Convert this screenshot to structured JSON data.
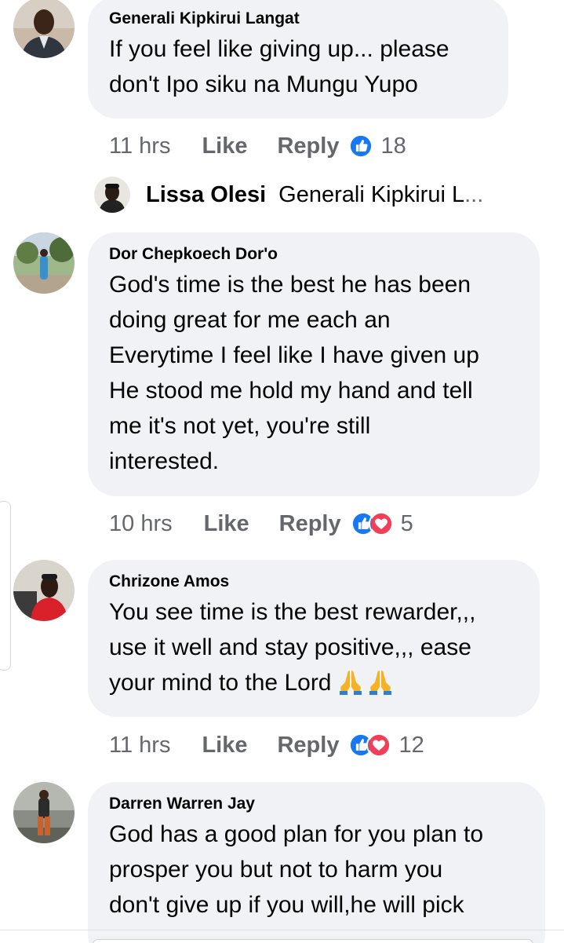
{
  "comments": [
    {
      "author": "Generali Kipkirui Langat",
      "lines": [
        "If you feel like giving up... please",
        "don't Ipo siku na Mungu Yupo"
      ],
      "time": "11 hrs",
      "like_label": "Like",
      "reply_label": "Reply",
      "reactions": [
        "like"
      ],
      "reaction_count": "18"
    },
    {
      "author": "Dor Chepkoech Dor'o",
      "lines": [
        "God's time is the best  he has been",
        "doing great for me each an",
        "Everytime I feel like I have given up",
        "He stood me hold my hand and tell",
        "me it's not yet, you're still",
        "interested."
      ],
      "time": "10 hrs",
      "like_label": "Like",
      "reply_label": "Reply",
      "reactions": [
        "like",
        "love"
      ],
      "reaction_count": "5"
    },
    {
      "author": "Chrizone Amos",
      "lines": [
        "You see time is the best rewarder,,,",
        "use it well and stay positive,,, ease",
        "your mind to the Lord"
      ],
      "emoji": [
        "folded-hands",
        "folded-hands"
      ],
      "time": "11 hrs",
      "like_label": "Like",
      "reply_label": "Reply",
      "reactions": [
        "like",
        "love"
      ],
      "reaction_count": "12"
    },
    {
      "author": "Darren Warren Jay",
      "lines": [
        "God has a good plan for you plan to",
        "prosper you but not to harm you",
        "don't give up if you will,he will pick"
      ]
    }
  ],
  "reply_preview": {
    "author": "Lissa Olesi",
    "snippet": "Generali Kipkirui L",
    "ellipsis": "..."
  },
  "colors": {
    "bubble": "#f0f2f5",
    "text": "#050505",
    "secondary": "#65676b",
    "like_blue": "#1877f2",
    "love_red": "#f33e58"
  }
}
